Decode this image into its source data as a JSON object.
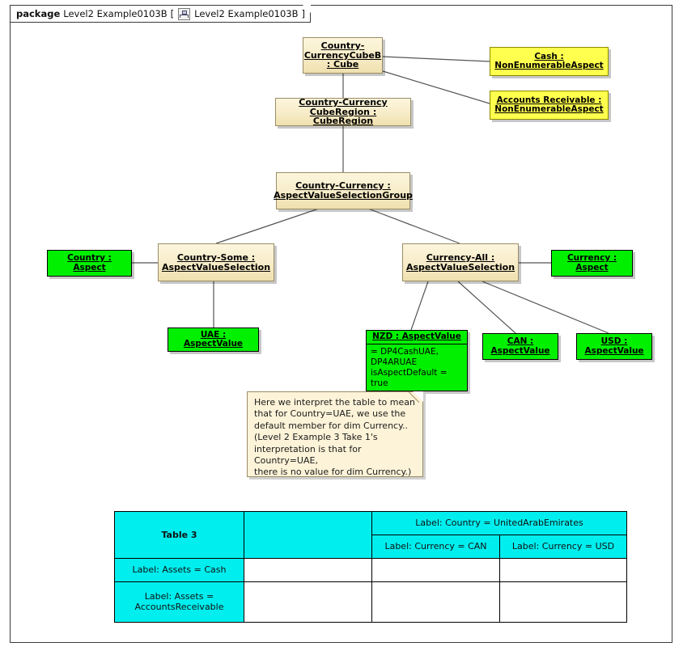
{
  "package": {
    "keyword": "package",
    "name": "Level2 Example0103B",
    "bracket_open": "[",
    "icon": "diagram-icon",
    "diagram_name": "Level2 Example0103B",
    "bracket_close": "]"
  },
  "nodes": {
    "cube": {
      "label": "Country-CurrencyCubeB : Cube",
      "kind": "cream"
    },
    "cube_region": {
      "label": "Country-Currency CubeRegion : CubeRegion",
      "kind": "cream"
    },
    "cash": {
      "label": "Cash : NonEnumerableAspect",
      "kind": "yellow"
    },
    "accounts_receivable": {
      "label": "Accounts Receivable : NonEnumerableAspect",
      "kind": "yellow"
    },
    "avs_group": {
      "label": "Country-Currency : AspectValueSelectionGroup",
      "kind": "cream"
    },
    "country_some": {
      "label": "Country-Some : AspectValueSelection",
      "kind": "cream"
    },
    "currency_all": {
      "label": "Currency-All : AspectValueSelection",
      "kind": "cream"
    },
    "country_aspect": {
      "label": "Country : Aspect",
      "kind": "green"
    },
    "currency_aspect": {
      "label": "Currency : Aspect",
      "kind": "green"
    },
    "uae": {
      "label": "UAE : AspectValue",
      "kind": "green"
    },
    "nzd": {
      "label": "NZD : AspectValue",
      "kind": "green",
      "attributes": [
        "= DP4CashUAE,",
        "DP4ARUAE",
        "isAspectDefault = true"
      ]
    },
    "can": {
      "label": "CAN : AspectValue",
      "kind": "green"
    },
    "usd": {
      "label": "USD : AspectValue",
      "kind": "green"
    }
  },
  "note": {
    "lines": [
      "Here we interpret the table to mean",
      "that for Country=UAE, we use the",
      "default member for dim Currency..",
      "(Level 2 Example 3 Take 1's",
      "interpretation is that for Country=UAE,",
      "there is no value for dim Currency.)"
    ]
  },
  "table": {
    "name": "Table 3",
    "col_country": "Label: Country = UnitedArabEmirates",
    "col_can": "Label: Currency = CAN",
    "col_usd": "Label: Currency = USD",
    "row_cash": "Label: Assets = Cash",
    "row_ar": "Label: Assets = AccountsReceivable",
    "cells": [
      [
        "",
        "",
        ""
      ],
      [
        "",
        "",
        ""
      ]
    ]
  },
  "colors": {
    "cream": "#f7ecc8",
    "yellow": "#ffff4d",
    "green": "#00f000",
    "cyan": "#00eeee",
    "note": "#fdf3d8",
    "line": "#555555"
  }
}
